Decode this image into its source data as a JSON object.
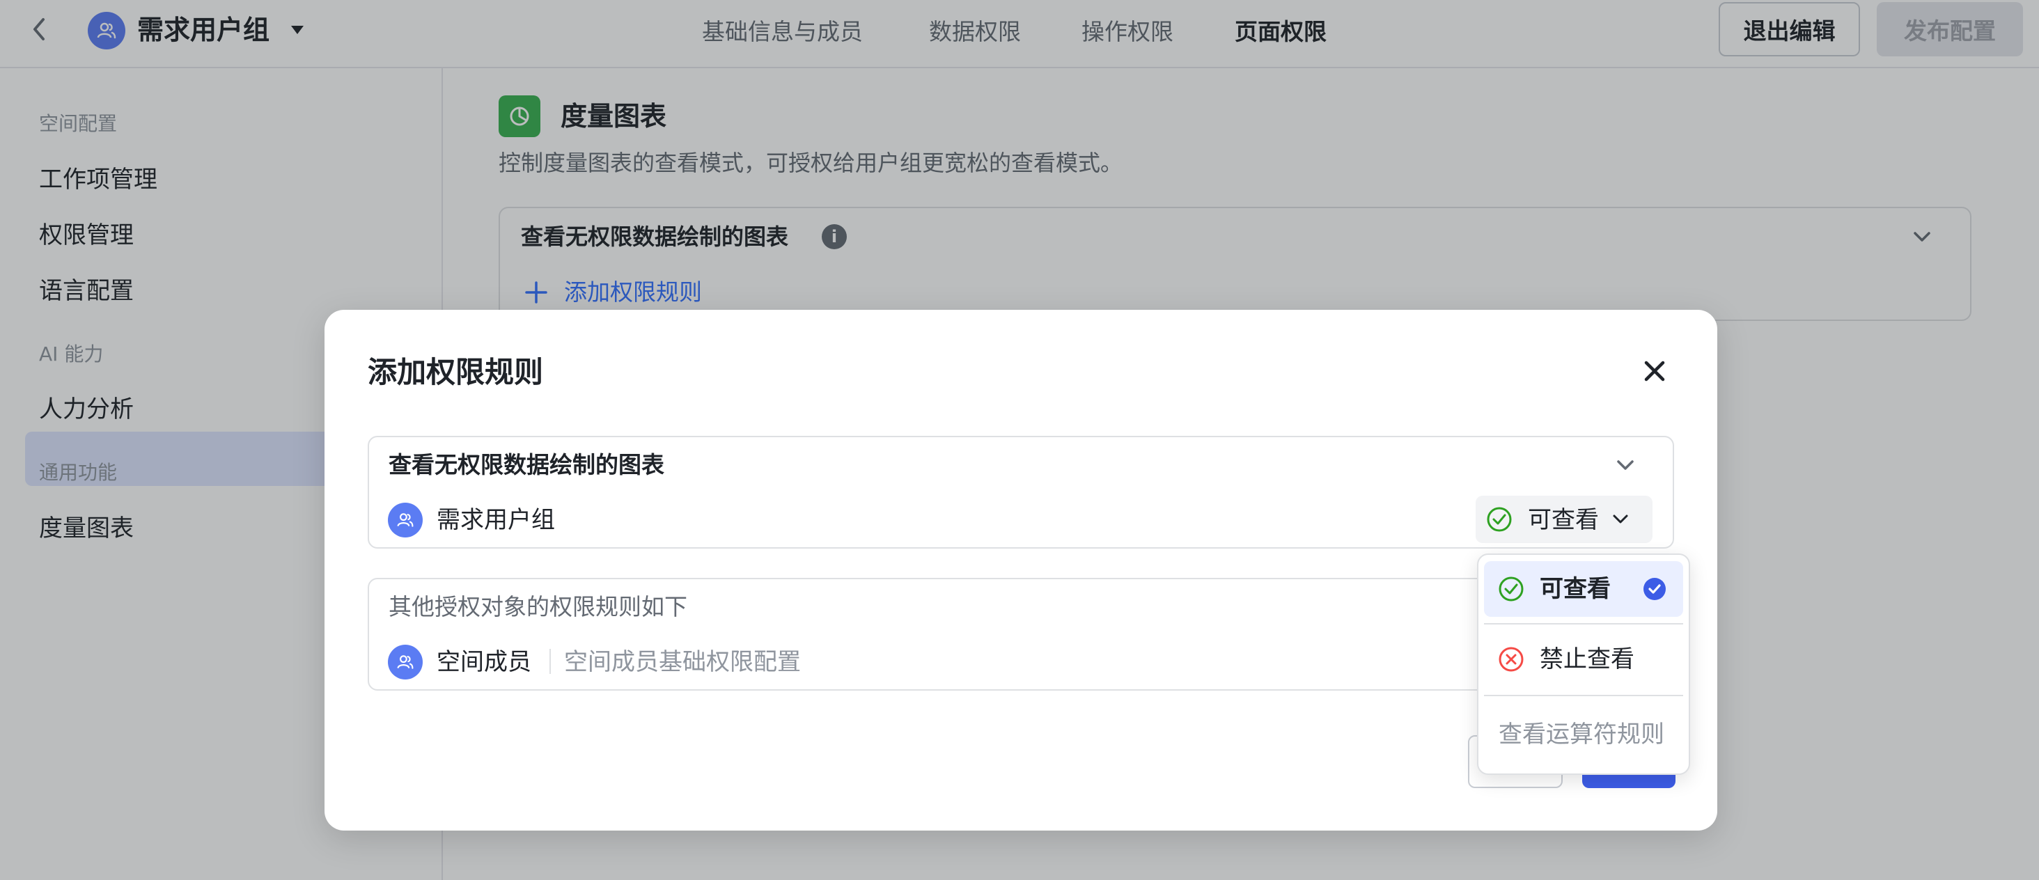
{
  "header": {
    "group_name": "需求用户组",
    "tabs": [
      {
        "label": "基础信息与成员",
        "active": false
      },
      {
        "label": "数据权限",
        "active": false
      },
      {
        "label": "操作权限",
        "active": false
      },
      {
        "label": "页面权限",
        "active": true
      }
    ],
    "exit_label": "退出编辑",
    "publish_label": "发布配置"
  },
  "sidebar": {
    "sections": [
      {
        "label": "空间配置",
        "items": [
          "工作项管理",
          "权限管理",
          "语言配置"
        ]
      },
      {
        "label": "AI 能力",
        "items": [
          "人力分析"
        ]
      },
      {
        "label": "通用功能",
        "items": [
          "度量图表"
        ]
      }
    ],
    "active_item": "度量图表"
  },
  "main": {
    "section_title": "度量图表",
    "section_desc": "控制度量图表的查看模式，可授权给用户组更宽松的查看模式。",
    "permission_title": "查看无权限数据绘制的图表",
    "info_icon": "i",
    "add_rule_label": "添加权限规则"
  },
  "modal": {
    "title": "添加权限规则",
    "rule_box": {
      "title": "查看无权限数据绘制的图表",
      "group_name": "需求用户组",
      "selected_value": "可查看"
    },
    "others_box": {
      "title": "其他授权对象的权限规则如下",
      "member_name": "空间成员",
      "member_desc": "空间成员基础权限配置"
    }
  },
  "dropdown": {
    "options": [
      {
        "label": "可查看",
        "selected": true
      },
      {
        "label": "禁止查看",
        "selected": false
      }
    ],
    "link_label": "查看运算符规则"
  },
  "colors": {
    "accent": "#3370ff",
    "primary_button": "#3c5ce6",
    "success": "#2ea121",
    "danger": "#f54a45",
    "section_icon": "#38b151",
    "avatar": "#5b7cf3"
  },
  "icons": [
    "back-arrow-icon",
    "users-icon",
    "caret-down-icon",
    "pie-chart-icon",
    "info-icon",
    "chevron-down-icon",
    "plus-icon",
    "close-icon",
    "check-circle-icon",
    "x-circle-icon",
    "checkmark-icon"
  ]
}
